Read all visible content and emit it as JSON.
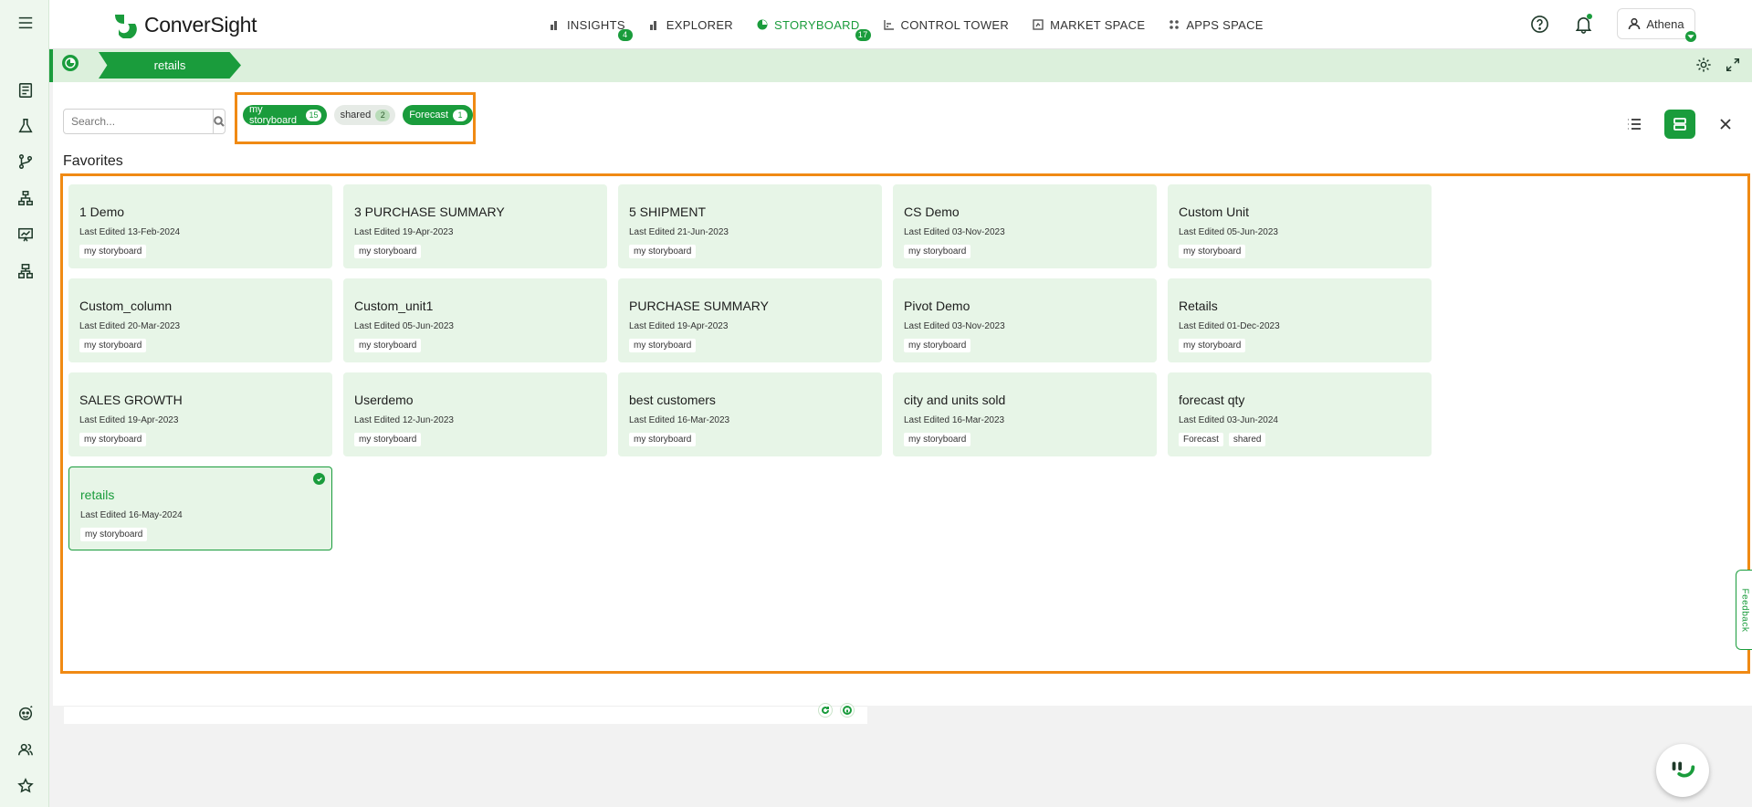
{
  "app": {
    "logo_text": "ConverSight"
  },
  "nav": {
    "items": [
      {
        "label": "INSIGHTS",
        "badge": "4"
      },
      {
        "label": "EXPLORER",
        "badge": ""
      },
      {
        "label": "STORYBOARD",
        "badge": "17"
      },
      {
        "label": "CONTROL TOWER",
        "badge": ""
      },
      {
        "label": "MARKET SPACE",
        "badge": ""
      },
      {
        "label": "APPS SPACE",
        "badge": ""
      }
    ]
  },
  "user": {
    "name": "Athena"
  },
  "breadcrumb": {
    "current": "retails"
  },
  "search": {
    "placeholder": "Search..."
  },
  "filters": [
    {
      "label": "my storyboard",
      "count": "15",
      "active": true
    },
    {
      "label": "shared",
      "count": "2",
      "active": false
    },
    {
      "label": "Forecast",
      "count": "1",
      "active": true
    }
  ],
  "section": {
    "title": "Favorites"
  },
  "cards": [
    {
      "title": "1 Demo",
      "edited": "Last Edited 13-Feb-2024",
      "tags": [
        "my storyboard"
      ]
    },
    {
      "title": "3 PURCHASE SUMMARY",
      "edited": "Last Edited 19-Apr-2023",
      "tags": [
        "my storyboard"
      ]
    },
    {
      "title": "5 SHIPMENT",
      "edited": "Last Edited 21-Jun-2023",
      "tags": [
        "my storyboard"
      ]
    },
    {
      "title": "CS Demo",
      "edited": "Last Edited 03-Nov-2023",
      "tags": [
        "my storyboard"
      ]
    },
    {
      "title": "Custom Unit",
      "edited": "Last Edited 05-Jun-2023",
      "tags": [
        "my storyboard"
      ]
    },
    {
      "title": "Custom_column",
      "edited": "Last Edited 20-Mar-2023",
      "tags": [
        "my storyboard"
      ]
    },
    {
      "title": "Custom_unit1",
      "edited": "Last Edited 05-Jun-2023",
      "tags": [
        "my storyboard"
      ]
    },
    {
      "title": "PURCHASE SUMMARY",
      "edited": "Last Edited 19-Apr-2023",
      "tags": [
        "my storyboard"
      ]
    },
    {
      "title": "Pivot Demo",
      "edited": "Last Edited 03-Nov-2023",
      "tags": [
        "my storyboard"
      ]
    },
    {
      "title": "Retails",
      "edited": "Last Edited 01-Dec-2023",
      "tags": [
        "my storyboard"
      ]
    },
    {
      "title": "SALES GROWTH",
      "edited": "Last Edited 19-Apr-2023",
      "tags": [
        "my storyboard"
      ]
    },
    {
      "title": "Userdemo",
      "edited": "Last Edited 12-Jun-2023",
      "tags": [
        "my storyboard"
      ]
    },
    {
      "title": "best customers",
      "edited": "Last Edited 16-Mar-2023",
      "tags": [
        "my storyboard"
      ]
    },
    {
      "title": "city and units sold",
      "edited": "Last Edited 16-Mar-2023",
      "tags": [
        "my storyboard"
      ]
    },
    {
      "title": "forecast qty",
      "edited": "Last Edited 03-Jun-2024",
      "tags": [
        "Forecast",
        "shared"
      ]
    },
    {
      "title": "retails",
      "edited": "Last Edited 16-May-2024",
      "tags": [
        "my storyboard"
      ],
      "selected": true
    }
  ],
  "feedback": {
    "label": "Feedback"
  },
  "colors": {
    "accent": "#1a9c3c",
    "highlight": "#f08a14",
    "card_bg": "#e7f5e7"
  }
}
